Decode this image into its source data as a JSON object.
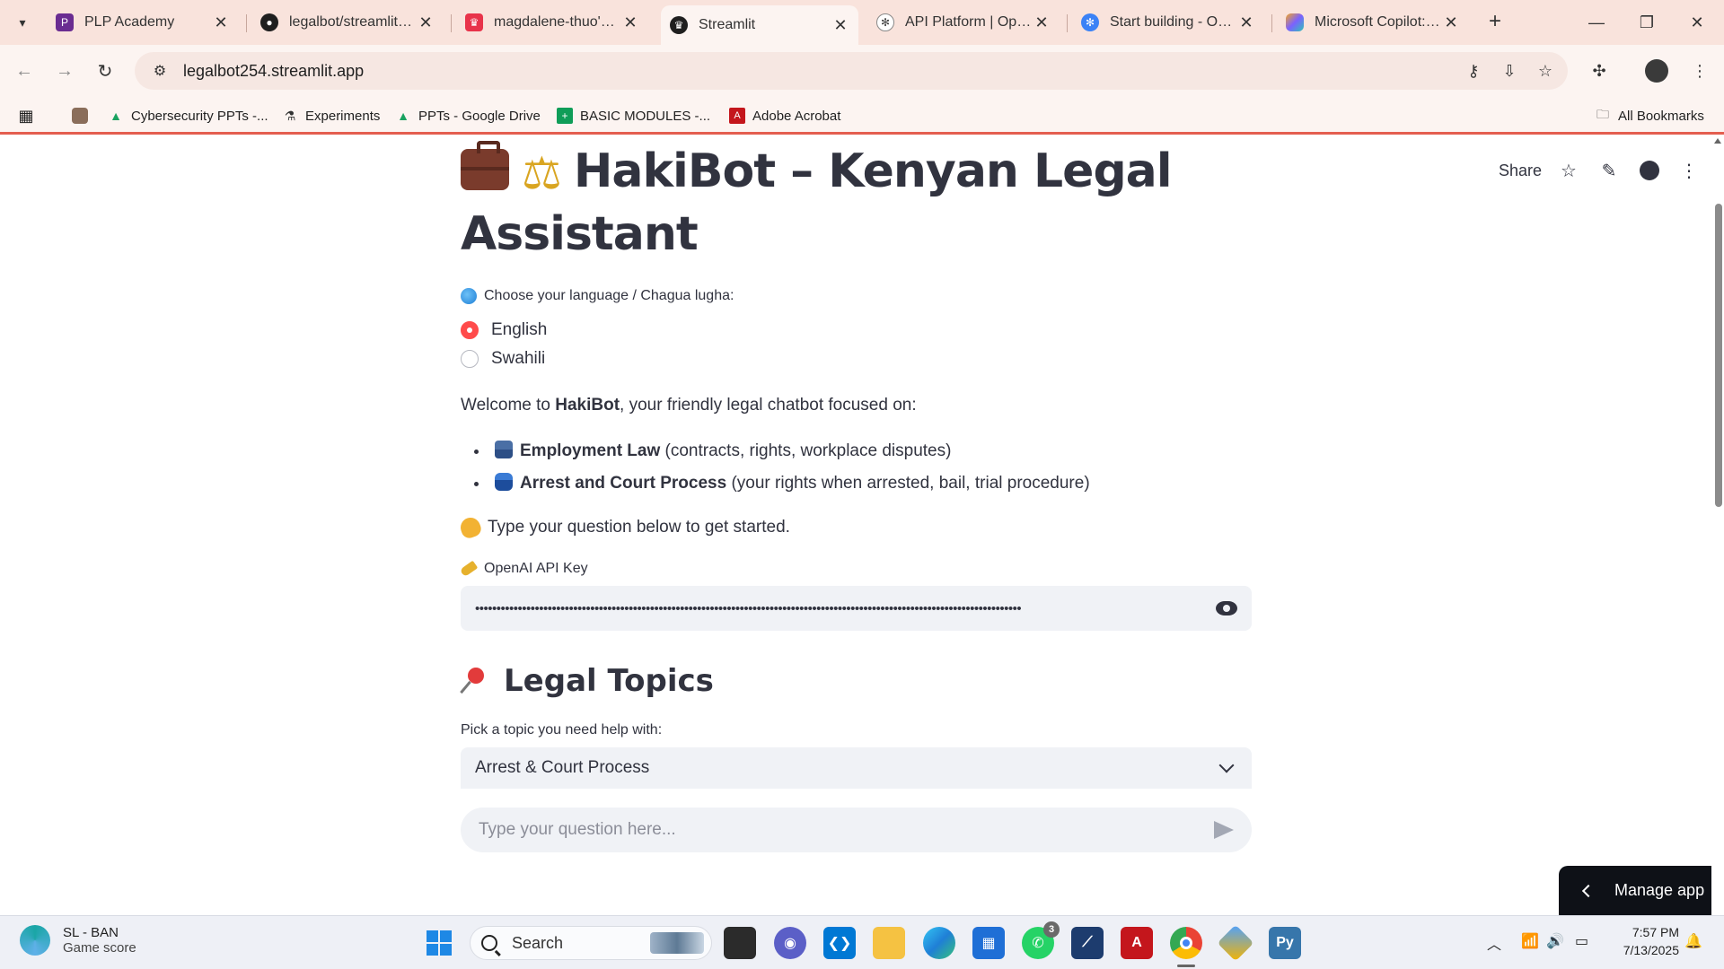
{
  "browser": {
    "tabs": [
      {
        "title": "PLP Academy",
        "icon": "plp-icon",
        "color": "#6a2c91"
      },
      {
        "title": "legalbot/streamlit_app",
        "icon": "github-icon",
        "color": "#1f1f1f"
      },
      {
        "title": "magdalene-thuo's app",
        "icon": "streamlit-crown-icon",
        "color": "#e8334a"
      },
      {
        "title": "Streamlit",
        "icon": "streamlit-icon",
        "color": "#1f1f1f",
        "active": true
      },
      {
        "title": "API Platform | OpenAI",
        "icon": "openai-icon",
        "color": "#444444"
      },
      {
        "title": "Start building - OpenAI",
        "icon": "openai-blue-icon",
        "color": "#3b82f6"
      },
      {
        "title": "Microsoft Copilot: Your AI",
        "icon": "copilot-icon",
        "color": "#7b61ff"
      }
    ],
    "url": "legalbot254.streamlit.app",
    "bookmarks": [
      {
        "label": "",
        "icon": "profile-bookmark-icon"
      },
      {
        "label": "Cybersecurity PPTs -...",
        "icon": "google-drive-icon"
      },
      {
        "label": "Experiments",
        "icon": "flask-icon"
      },
      {
        "label": "PPTs - Google Drive",
        "icon": "google-drive-icon"
      },
      {
        "label": "BASIC MODULES -...",
        "icon": "sheets-icon"
      },
      {
        "label": "Adobe Acrobat",
        "icon": "acrobat-icon"
      }
    ],
    "all_bookmarks": "All Bookmarks"
  },
  "streamlit_header": {
    "share": "Share"
  },
  "app": {
    "title": "HakiBot – Kenyan Legal Assistant",
    "language_label": "Choose your language / Chagua lugha:",
    "languages": [
      "English",
      "Swahili"
    ],
    "selected_language": "English",
    "welcome_prefix": "Welcome to ",
    "welcome_bold": "HakiBot",
    "welcome_suffix": ", your friendly legal chatbot focused on:",
    "topics_list": [
      {
        "bold": "Employment Law",
        "rest": " (contracts, rights, workplace disputes)"
      },
      {
        "bold": "Arrest and Court Process",
        "rest": " (your rights when arrested, bail, trial procedure)"
      }
    ],
    "type_prompt": "Type your question below to get started.",
    "api_key_label": "OpenAI API Key",
    "api_key_masked": "••••••••••••••••••••••••••••••••••••••••••••••••••••••••••••••••••••••••••••••••••••••••••••••••••••••••••••••••••••••••••••••••",
    "legal_topics_heading": "Legal Topics",
    "pick_topic_label": "Pick a topic you need help with:",
    "selected_topic": "Arrest & Court Process",
    "chat_placeholder": "Type your question here...",
    "manage_app": "Manage app",
    "accent": "#ff4b4b"
  },
  "taskbar": {
    "weather_title": "SL - BAN",
    "weather_sub": "Game score",
    "search": "Search",
    "whatsapp_badge": "3",
    "time": "7:57 PM",
    "date": "7/13/2025"
  }
}
